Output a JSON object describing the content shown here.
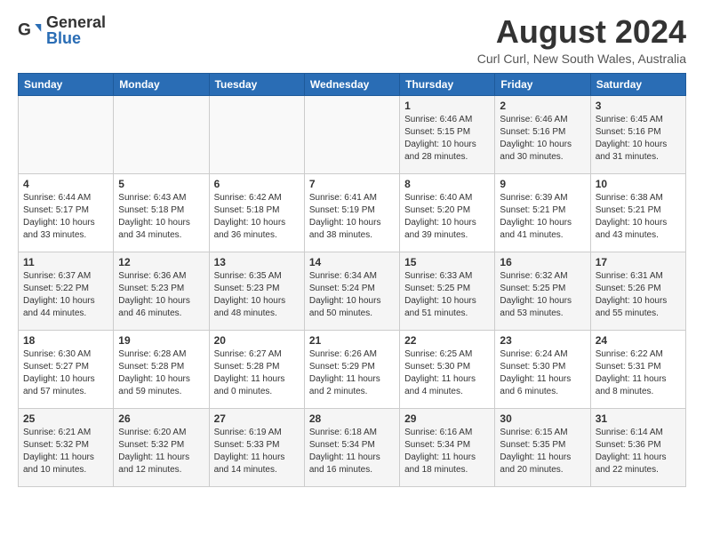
{
  "header": {
    "logo_general": "General",
    "logo_blue": "Blue",
    "month_year": "August 2024",
    "location": "Curl Curl, New South Wales, Australia"
  },
  "weekdays": [
    "Sunday",
    "Monday",
    "Tuesday",
    "Wednesday",
    "Thursday",
    "Friday",
    "Saturday"
  ],
  "weeks": [
    [
      {
        "day": "",
        "info": ""
      },
      {
        "day": "",
        "info": ""
      },
      {
        "day": "",
        "info": ""
      },
      {
        "day": "",
        "info": ""
      },
      {
        "day": "1",
        "info": "Sunrise: 6:46 AM\nSunset: 5:15 PM\nDaylight: 10 hours\nand 28 minutes."
      },
      {
        "day": "2",
        "info": "Sunrise: 6:46 AM\nSunset: 5:16 PM\nDaylight: 10 hours\nand 30 minutes."
      },
      {
        "day": "3",
        "info": "Sunrise: 6:45 AM\nSunset: 5:16 PM\nDaylight: 10 hours\nand 31 minutes."
      }
    ],
    [
      {
        "day": "4",
        "info": "Sunrise: 6:44 AM\nSunset: 5:17 PM\nDaylight: 10 hours\nand 33 minutes."
      },
      {
        "day": "5",
        "info": "Sunrise: 6:43 AM\nSunset: 5:18 PM\nDaylight: 10 hours\nand 34 minutes."
      },
      {
        "day": "6",
        "info": "Sunrise: 6:42 AM\nSunset: 5:18 PM\nDaylight: 10 hours\nand 36 minutes."
      },
      {
        "day": "7",
        "info": "Sunrise: 6:41 AM\nSunset: 5:19 PM\nDaylight: 10 hours\nand 38 minutes."
      },
      {
        "day": "8",
        "info": "Sunrise: 6:40 AM\nSunset: 5:20 PM\nDaylight: 10 hours\nand 39 minutes."
      },
      {
        "day": "9",
        "info": "Sunrise: 6:39 AM\nSunset: 5:21 PM\nDaylight: 10 hours\nand 41 minutes."
      },
      {
        "day": "10",
        "info": "Sunrise: 6:38 AM\nSunset: 5:21 PM\nDaylight: 10 hours\nand 43 minutes."
      }
    ],
    [
      {
        "day": "11",
        "info": "Sunrise: 6:37 AM\nSunset: 5:22 PM\nDaylight: 10 hours\nand 44 minutes."
      },
      {
        "day": "12",
        "info": "Sunrise: 6:36 AM\nSunset: 5:23 PM\nDaylight: 10 hours\nand 46 minutes."
      },
      {
        "day": "13",
        "info": "Sunrise: 6:35 AM\nSunset: 5:23 PM\nDaylight: 10 hours\nand 48 minutes."
      },
      {
        "day": "14",
        "info": "Sunrise: 6:34 AM\nSunset: 5:24 PM\nDaylight: 10 hours\nand 50 minutes."
      },
      {
        "day": "15",
        "info": "Sunrise: 6:33 AM\nSunset: 5:25 PM\nDaylight: 10 hours\nand 51 minutes."
      },
      {
        "day": "16",
        "info": "Sunrise: 6:32 AM\nSunset: 5:25 PM\nDaylight: 10 hours\nand 53 minutes."
      },
      {
        "day": "17",
        "info": "Sunrise: 6:31 AM\nSunset: 5:26 PM\nDaylight: 10 hours\nand 55 minutes."
      }
    ],
    [
      {
        "day": "18",
        "info": "Sunrise: 6:30 AM\nSunset: 5:27 PM\nDaylight: 10 hours\nand 57 minutes."
      },
      {
        "day": "19",
        "info": "Sunrise: 6:28 AM\nSunset: 5:28 PM\nDaylight: 10 hours\nand 59 minutes."
      },
      {
        "day": "20",
        "info": "Sunrise: 6:27 AM\nSunset: 5:28 PM\nDaylight: 11 hours\nand 0 minutes."
      },
      {
        "day": "21",
        "info": "Sunrise: 6:26 AM\nSunset: 5:29 PM\nDaylight: 11 hours\nand 2 minutes."
      },
      {
        "day": "22",
        "info": "Sunrise: 6:25 AM\nSunset: 5:30 PM\nDaylight: 11 hours\nand 4 minutes."
      },
      {
        "day": "23",
        "info": "Sunrise: 6:24 AM\nSunset: 5:30 PM\nDaylight: 11 hours\nand 6 minutes."
      },
      {
        "day": "24",
        "info": "Sunrise: 6:22 AM\nSunset: 5:31 PM\nDaylight: 11 hours\nand 8 minutes."
      }
    ],
    [
      {
        "day": "25",
        "info": "Sunrise: 6:21 AM\nSunset: 5:32 PM\nDaylight: 11 hours\nand 10 minutes."
      },
      {
        "day": "26",
        "info": "Sunrise: 6:20 AM\nSunset: 5:32 PM\nDaylight: 11 hours\nand 12 minutes."
      },
      {
        "day": "27",
        "info": "Sunrise: 6:19 AM\nSunset: 5:33 PM\nDaylight: 11 hours\nand 14 minutes."
      },
      {
        "day": "28",
        "info": "Sunrise: 6:18 AM\nSunset: 5:34 PM\nDaylight: 11 hours\nand 16 minutes."
      },
      {
        "day": "29",
        "info": "Sunrise: 6:16 AM\nSunset: 5:34 PM\nDaylight: 11 hours\nand 18 minutes."
      },
      {
        "day": "30",
        "info": "Sunrise: 6:15 AM\nSunset: 5:35 PM\nDaylight: 11 hours\nand 20 minutes."
      },
      {
        "day": "31",
        "info": "Sunrise: 6:14 AM\nSunset: 5:36 PM\nDaylight: 11 hours\nand 22 minutes."
      }
    ]
  ]
}
